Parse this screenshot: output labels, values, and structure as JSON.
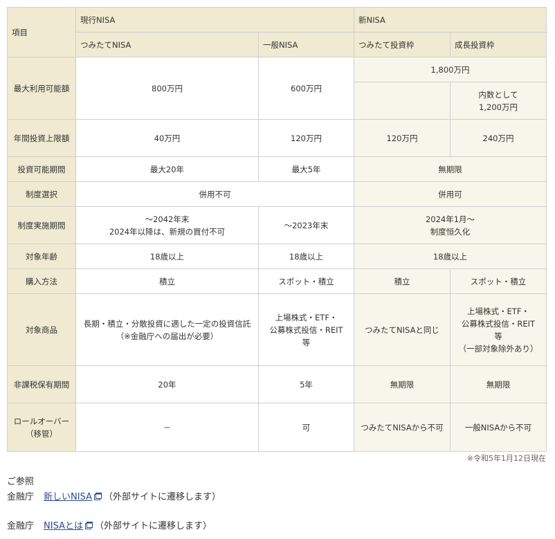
{
  "table": {
    "h_item": "項目",
    "h_current": "現行NISA",
    "h_new": "新NISA",
    "h_tsumitate": "つみたてNISA",
    "h_ippan": "一般NISA",
    "h_tsumitate_waku": "つみたて投資枠",
    "h_seicho_waku": "成長投資枠",
    "max_label": "最大利用可能額",
    "max_tsumitate": "800万円",
    "max_ippan": "600万円",
    "max_new_total": "1,800万円",
    "max_seicho_l1": "内数として",
    "max_seicho_l2": "1,200万円",
    "annual_label": "年間投資上限額",
    "annual_tsumitate": "40万円",
    "annual_ippan": "120万円",
    "annual_new_tsumitate": "120万円",
    "annual_new_seicho": "240万円",
    "period_label": "投資可能期間",
    "period_tsumitate": "最大20年",
    "period_ippan": "最大5年",
    "period_new": "無期限",
    "select_label": "制度選択",
    "select_current": "併用不可",
    "select_new": "併用可",
    "impl_label": "制度実施期間",
    "impl_tsumitate_l1": "～2042年末",
    "impl_tsumitate_l2": "2024年以降は、新規の買付不可",
    "impl_ippan": "～2023年末",
    "impl_new_l1": "2024年1月～",
    "impl_new_l2": "制度恒久化",
    "age_label": "対象年齢",
    "age_tsumitate": "18歳以上",
    "age_ippan": "18歳以上",
    "age_new": "18歳以上",
    "buy_label": "購入方法",
    "buy_tsumitate": "積立",
    "buy_ippan": "スポット・積立",
    "buy_new_tsumitate": "積立",
    "buy_new_seicho": "スポット・積立",
    "prod_label": "対象商品",
    "prod_tsumitate_l1": "長期・積立・分散投資に適した一定の投資信託",
    "prod_tsumitate_l2": "（※金融庁への届出が必要）",
    "prod_ippan_l1": "上場株式・ETF・",
    "prod_ippan_l2": "公募株式投信・REIT",
    "prod_ippan_l3": "等",
    "prod_new_tsumitate": "つみたてNISAと同じ",
    "prod_new_seicho_l1": "上場株式・ETF・",
    "prod_new_seicho_l2": "公募株式投信・REIT",
    "prod_new_seicho_l3": "等",
    "prod_new_seicho_l4": "（一部対象除外あり）",
    "hold_label": "非課税保有期間",
    "hold_tsumitate": "20年",
    "hold_ippan": "5年",
    "hold_new_tsumitate": "無期限",
    "hold_new_seicho": "無期限",
    "roll_label_l1": "ロールオーバー",
    "roll_label_l2": "（移管）",
    "roll_tsumitate": "－",
    "roll_ippan": "可",
    "roll_new_tsumitate": "つみたてNISAから不可",
    "roll_new_seicho": "一般NISAから不可"
  },
  "note": "※令和5年1月12日現在",
  "refs": {
    "title": "ご参照",
    "org1": "金融庁",
    "link1": "新しいNISA",
    "ext1": "（外部サイトに遷移します）",
    "org2": "金融庁",
    "link2": "NISAとは",
    "ext2": "（外部サイトに遷移します）"
  },
  "icons": {
    "external": "external-link-icon"
  },
  "colors": {
    "header_bg": "#efead1",
    "new_bg": "#f8f6ea",
    "link": "#2a4a8c"
  }
}
